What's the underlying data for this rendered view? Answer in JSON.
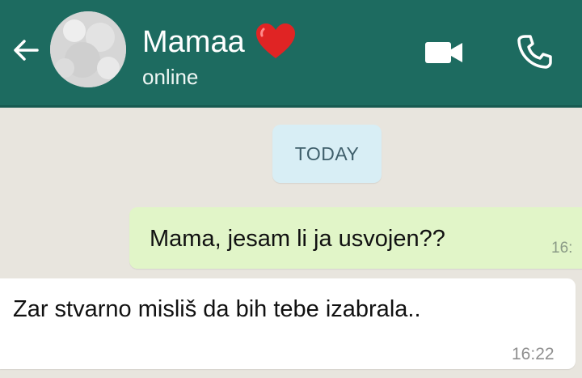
{
  "header": {
    "contact_name": "Mamaa",
    "status": "online",
    "icons": {
      "back": "arrow-back-icon",
      "avatar": "avatar",
      "heart": "heart-icon",
      "video": "video-call-icon",
      "call": "phone-icon"
    },
    "colors": {
      "bar": "#1d6b60",
      "heart": "#e02424"
    }
  },
  "chat": {
    "date_label": "TODAY",
    "messages": [
      {
        "direction": "outgoing",
        "text": "Mama, jesam li ja usvojen??",
        "time": "16:"
      },
      {
        "direction": "incoming",
        "text": "Zar stvarno misliš da bih tebe izabrala..",
        "time": "16:22"
      }
    ],
    "colors": {
      "outgoing": "#e1f5c8",
      "incoming": "#ffffff",
      "date_chip": "#d8eef5"
    }
  }
}
